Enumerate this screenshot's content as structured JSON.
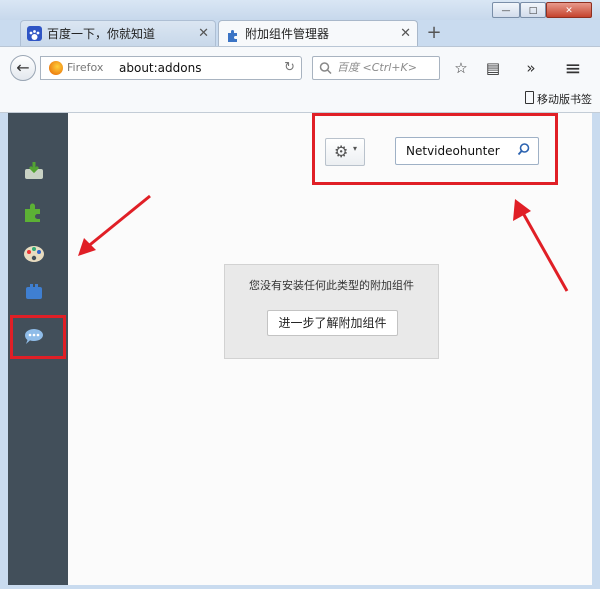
{
  "window": {
    "controls": {
      "minimize": "—",
      "maximize": "□",
      "close": "✕"
    }
  },
  "tabs": [
    {
      "label": "百度一下，你就知道",
      "icon": "paw-icon",
      "active": false,
      "close": "✕"
    },
    {
      "label": "附加组件管理器",
      "icon": "puzzle-icon",
      "active": true,
      "close": "✕"
    }
  ],
  "new_tab": "+",
  "navbar": {
    "back": "←",
    "identity": "Firefox",
    "url": "about:addons",
    "reload": "↻",
    "search_placeholder": "百度 <Ctrl+K>",
    "toolbar_icons": [
      "star-icon",
      "library-icon",
      "overflow-icon",
      "menu-icon"
    ],
    "toolbar_glyphs": {
      "star": "☆",
      "library": "▤",
      "overflow": "»",
      "menu": "≡"
    }
  },
  "bookmarks_bar": {
    "mobile_bookmarks": "移动版书签"
  },
  "sidebar": {
    "categories": [
      {
        "name": "get-addons",
        "icon": "download-icon"
      },
      {
        "name": "extensions",
        "icon": "puzzle-icon"
      },
      {
        "name": "appearance",
        "icon": "palette-icon"
      },
      {
        "name": "plugins",
        "icon": "plugin-icon"
      },
      {
        "name": "services",
        "icon": "chat-bubble-icon",
        "selected": true
      }
    ]
  },
  "main": {
    "tools_button": "⚙",
    "tools_dropdown": "▾",
    "search_value": "Netvideohunter",
    "empty_message": "您没有安装任何此类型的附加组件",
    "learn_more": "进一步了解附加组件"
  },
  "colors": {
    "sidebar_bg": "#424f5a",
    "annotation_red": "#e01f26",
    "chrome_blue": "#c9dbef"
  }
}
